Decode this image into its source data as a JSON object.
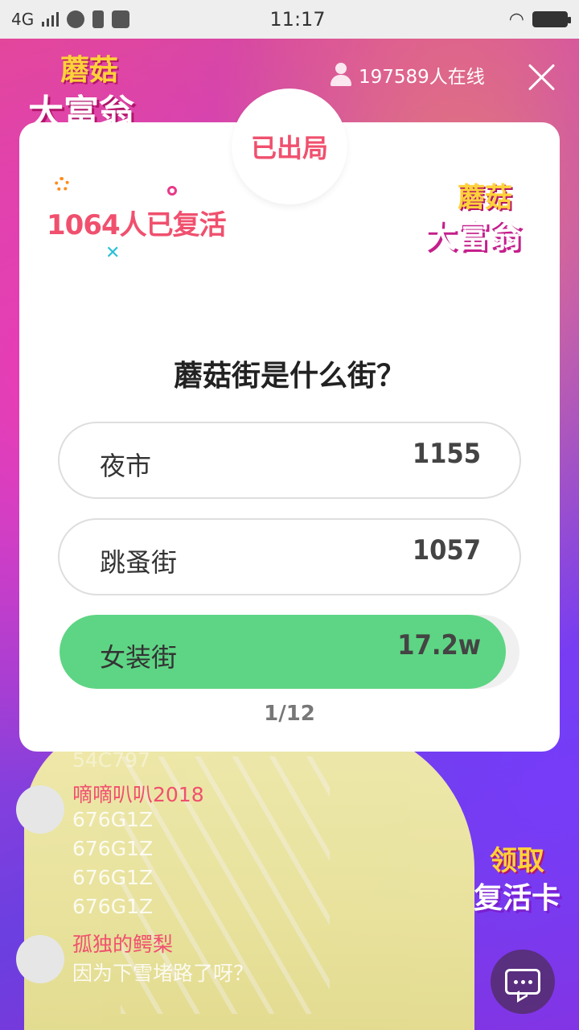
{
  "status_bar": {
    "network": "4G",
    "time": "11:17"
  },
  "header": {
    "brand_line1": "蘑菇",
    "brand_line2": "大富翁",
    "online_count": "197589人在线"
  },
  "card": {
    "status": "已出局",
    "revived_text": "1064人已复活",
    "logo_line1": "蘑菇",
    "logo_line2": "大富翁",
    "question": "蘑菇街是什么街？",
    "options": [
      {
        "label": "夜市",
        "count": "1155",
        "selected": false,
        "share": 0.0
      },
      {
        "label": "跳蚤街",
        "count": "1057",
        "selected": false,
        "share": 0.0
      },
      {
        "label": "女装街",
        "count": "17.2w",
        "selected": true,
        "share": 0.97
      }
    ],
    "page_indicator": "1/12"
  },
  "chat": {
    "lines": [
      {
        "text": "54C797",
        "type": "message"
      },
      {
        "text": "嘀嘀叭叭2018",
        "type": "user"
      },
      {
        "text": "676G1Z",
        "type": "message"
      },
      {
        "text": "676G1Z",
        "type": "message"
      },
      {
        "text": "676G1Z",
        "type": "message"
      },
      {
        "text": "676G1Z",
        "type": "message"
      },
      {
        "text": "孤独的鳄梨",
        "type": "user"
      },
      {
        "text": "因为下雪堵路了呀？",
        "type": "message"
      }
    ]
  },
  "claim_card": {
    "line1": "领取",
    "line2": "复活卡"
  },
  "colors": {
    "accent_red": "#f0506e",
    "correct_green": "#5ed584"
  }
}
